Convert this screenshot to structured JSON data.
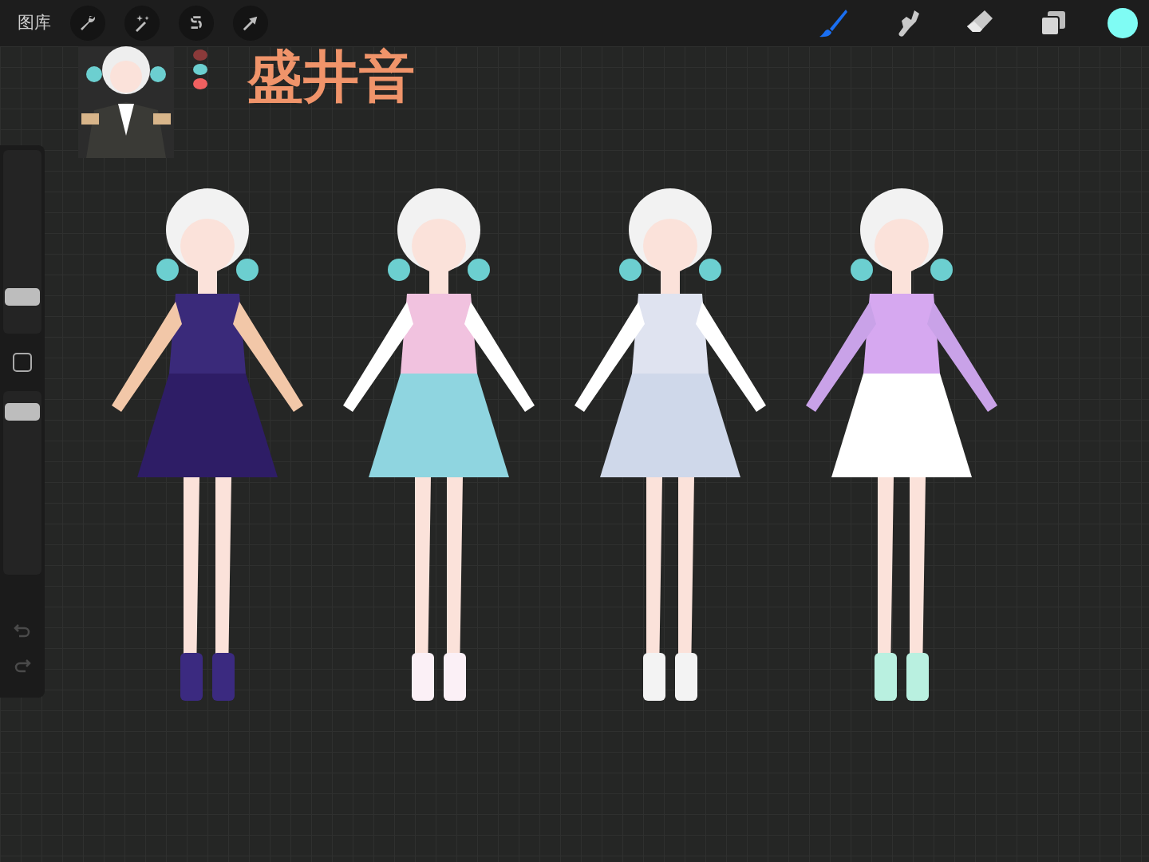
{
  "top_bar": {
    "gallery_label": "图库",
    "left_tools": [
      {
        "kind": "wrench"
      },
      {
        "kind": "wand"
      },
      {
        "kind": "selection"
      },
      {
        "kind": "transform"
      }
    ],
    "paint_tools": [
      {
        "kind": "brush",
        "selected": true
      },
      {
        "kind": "smudge",
        "selected": false
      },
      {
        "kind": "eraser",
        "selected": false
      }
    ],
    "layers_button": {
      "kind": "layers"
    },
    "current_color": {
      "color": "#7ffcf4"
    }
  },
  "side_bar": {
    "size_slider": {
      "level": 0.17
    },
    "opacity_slider": {
      "level": 0.93
    }
  },
  "canvas": {
    "title": "盛井音",
    "palette": [
      {
        "color": "#8a3a3a"
      },
      {
        "color": "#6ccfd0"
      },
      {
        "color": "#f06060"
      }
    ],
    "figures": [
      {
        "kind": "galaxy"
      },
      {
        "kind": "pastel"
      },
      {
        "kind": "white"
      },
      {
        "kind": "lilac"
      }
    ]
  }
}
